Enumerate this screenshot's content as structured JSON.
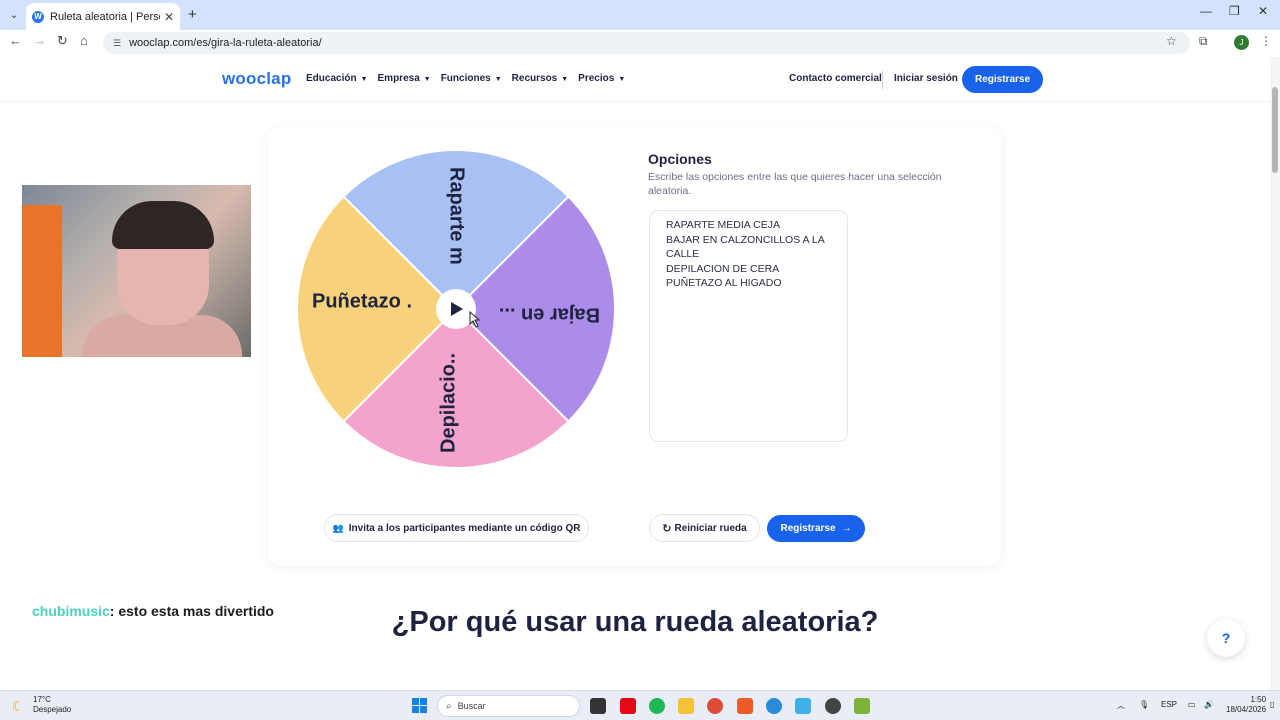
{
  "browser": {
    "tab_title": "Ruleta aleatoria | Personaliza y",
    "url": "wooclap.com/es/gira-la-ruleta-aleatoria/",
    "profile_initial": "J"
  },
  "header": {
    "logo": "wooclap",
    "nav": [
      "Educación",
      "Empresa",
      "Funciones",
      "Recursos",
      "Precios"
    ],
    "contact": "Contacto comercial",
    "login": "Iniciar sesión",
    "register": "Registrarse"
  },
  "wheel": {
    "segments": [
      {
        "label": "Raparte m",
        "color": "#a8c0f4"
      },
      {
        "label": "Bajar en ...",
        "color": "#ac8ce9"
      },
      {
        "label": "Depilacio..",
        "color": "#f4a3cc"
      },
      {
        "label": "Puñetazo .",
        "color": "#f8d27a"
      }
    ]
  },
  "options": {
    "title": "Opciones",
    "description": "Escribe las opciones entre las que quieres hacer una selección aleatoria.",
    "items": [
      "RAPARTE MEDIA CEJA",
      "BAJAR EN CALZONCILLOS A LA CALLE",
      "DEPILACION DE CERA",
      "PUÑETAZO AL HIGADO"
    ]
  },
  "actions": {
    "invite": "Invita a los participantes mediante un código QR",
    "reset": "Reiniciar rueda",
    "register": "Registrarse"
  },
  "section_heading": "¿Por qué usar una rueda aleatoria?",
  "help_label": "?",
  "chat": {
    "user": "chubimusic",
    "message": ": esto esta mas divertido"
  },
  "taskbar": {
    "temp": "17°C",
    "weather": "Despejado",
    "search": "Buscar",
    "lang": "ESP",
    "time": "1:50",
    "date": "18/04/2026"
  }
}
